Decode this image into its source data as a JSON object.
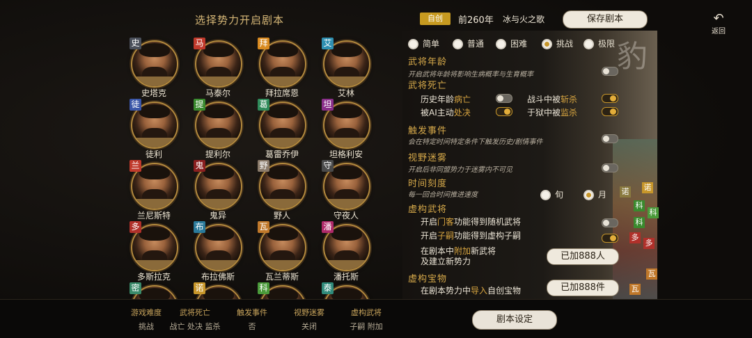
{
  "left_title": "选择势力开启剧本",
  "heroes": [
    {
      "badge": "史",
      "badge_color": "#4a4f5a",
      "name": "史塔克"
    },
    {
      "badge": "马",
      "badge_color": "#c0392b",
      "name": "马泰尔"
    },
    {
      "badge": "拜",
      "badge_color": "#d98a1f",
      "name": "拜拉席恩"
    },
    {
      "badge": "艾",
      "badge_color": "#2f8fb0",
      "name": "艾林"
    },
    {
      "badge": "徒",
      "badge_color": "#3a56a8",
      "name": "徒利"
    },
    {
      "badge": "提",
      "badge_color": "#3a8a2e",
      "name": "提利尔"
    },
    {
      "badge": "葛",
      "badge_color": "#2f8a5a",
      "name": "葛雷乔伊"
    },
    {
      "badge": "坦",
      "badge_color": "#8a2f8a",
      "name": "坦格利安"
    },
    {
      "badge": "兰",
      "badge_color": "#c0392b",
      "name": "兰尼斯特"
    },
    {
      "badge": "鬼",
      "badge_color": "#8a1f1f",
      "name": "鬼异"
    },
    {
      "badge": "野",
      "badge_color": "#8a7a6a",
      "name": "野人"
    },
    {
      "badge": "守",
      "badge_color": "#4a4a4a",
      "name": "守夜人"
    },
    {
      "badge": "多",
      "badge_color": "#b0302a",
      "name": "多斯拉克"
    },
    {
      "badge": "布",
      "badge_color": "#2a7a9a",
      "name": "布拉佛斯"
    },
    {
      "badge": "瓦",
      "badge_color": "#c0782a",
      "name": "瓦兰蒂斯"
    },
    {
      "badge": "潘",
      "badge_color": "#b02a6a",
      "name": "潘托斯"
    },
    {
      "badge": "密",
      "badge_color": "#3a8a6a",
      "name": ""
    },
    {
      "badge": "诺",
      "badge_color": "#c7962a",
      "name": ""
    },
    {
      "badge": "科",
      "badge_color": "#4a9a3a",
      "name": ""
    },
    {
      "badge": "泰",
      "badge_color": "#2f8a7a",
      "name": ""
    }
  ],
  "header": {
    "tag": "自创",
    "year": "前260年",
    "scenario": "冰与火之歌",
    "save_label": "保存剧本",
    "back_label": "返回"
  },
  "difficulty": {
    "options": [
      "简单",
      "普通",
      "困难",
      "挑战",
      "极限"
    ],
    "selected": "挑战"
  },
  "sections": {
    "age": {
      "title": "武将年龄",
      "desc": "开启武将年龄将影响生病概率与生育概率",
      "on": false
    },
    "death": {
      "title": "武将死亡",
      "items": [
        {
          "pre": "历史年龄",
          "hl": "病亡",
          "on": false
        },
        {
          "pre": "战斗中被",
          "hl": "斩杀",
          "on": true
        },
        {
          "pre": "被AI主动",
          "hl": "处决",
          "on": true
        },
        {
          "pre": "于狱中被",
          "hl": "监杀",
          "on": true
        }
      ]
    },
    "event": {
      "title": "触发事件",
      "desc": "会在特定时间特定条件下触发历史/剧情事件",
      "on": false
    },
    "fog": {
      "title": "视野迷雾",
      "desc": "开启后非同盟势力于迷雾内不可见",
      "on": false
    },
    "time": {
      "title": "时间刻度",
      "desc": "每一回合时间推进速度",
      "options": [
        "旬",
        "月"
      ],
      "selected": "月"
    },
    "virtual": {
      "title": "虚构武将",
      "items": [
        {
          "pre": "开启",
          "hl": "门客",
          "post": "功能得到随机武将",
          "on": false
        },
        {
          "pre": "开启",
          "hl": "子嗣",
          "post": "功能得到虚构子嗣",
          "on": true
        }
      ],
      "add_line1_pre": "在剧本中",
      "add_line1_hl": "附加",
      "add_line1_post": "新武将",
      "add_line2": "及建立新势力",
      "added_label": "已加888人"
    },
    "treasure": {
      "title": "虚构宝物",
      "line_pre": "在剧本势力中",
      "line_hl": "导入",
      "line_post": "自创宝物",
      "added_label": "已加888件"
    }
  },
  "bottom": {
    "cols": [
      {
        "label": "游戏难度",
        "value": "挑战"
      },
      {
        "label": "武将死亡",
        "value": "战亡 处决 监杀"
      },
      {
        "label": "触发事件",
        "value": "否"
      },
      {
        "label": "视野迷雾",
        "value": "关闭"
      },
      {
        "label": "虚构武将",
        "value": "子嗣 附加"
      }
    ],
    "setting_label": "剧本设定"
  },
  "map_cells": [
    {
      "t": "诺",
      "c": "#c7962a"
    },
    {
      "t": "诺",
      "c": "#8a7a40"
    },
    {
      "t": "科",
      "c": "#4a9a3a"
    },
    {
      "t": "科",
      "c": "#3a8a2e"
    },
    {
      "t": "科",
      "c": "#3a8a2e"
    },
    {
      "t": "多",
      "c": "#b0302a"
    },
    {
      "t": "多",
      "c": "#b0302a"
    },
    {
      "t": "瓦",
      "c": "#c0782a"
    },
    {
      "t": "瓦",
      "c": "#c0782a"
    }
  ],
  "deco_glyph": "豹"
}
